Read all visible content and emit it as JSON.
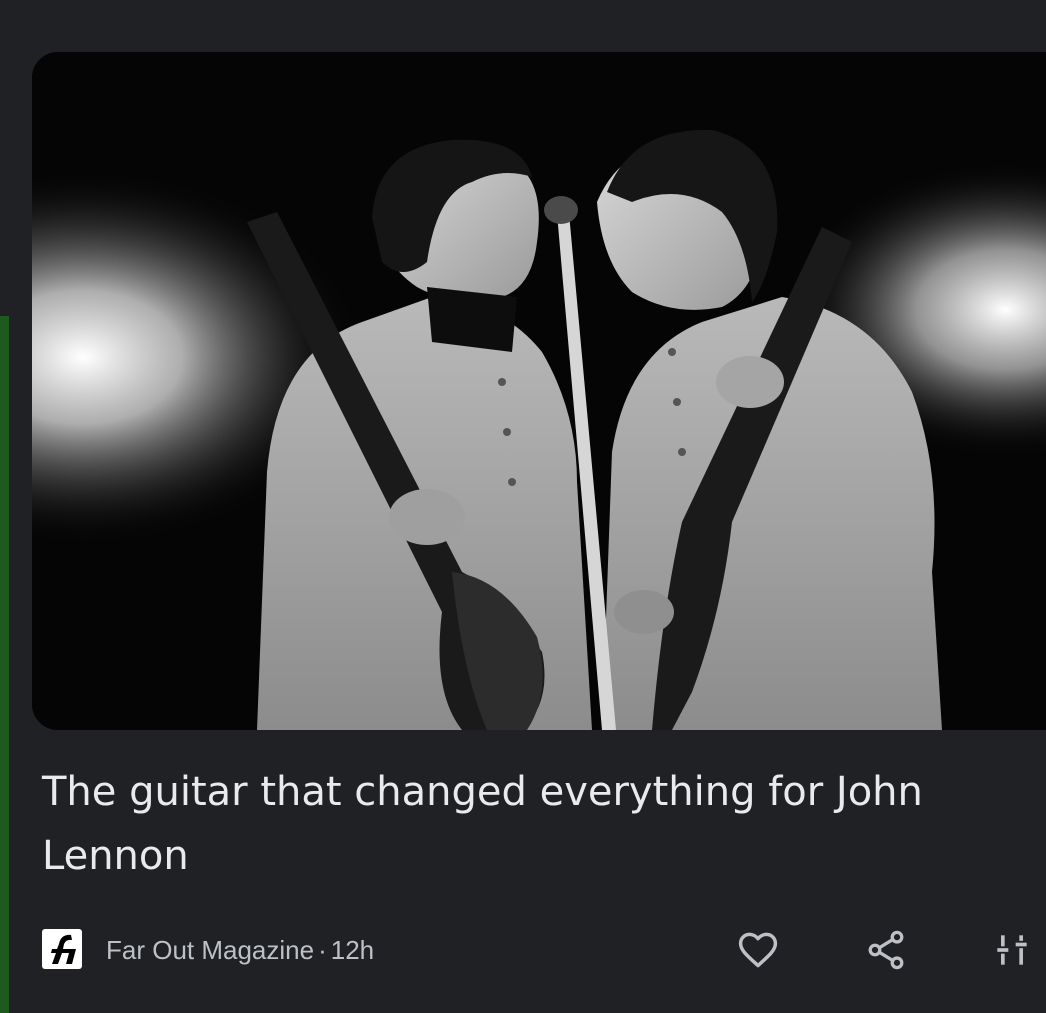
{
  "article": {
    "headline": "The guitar that changed everything for John Lennon",
    "image": {
      "alt": "Black-and-white photo of two musicians in collarless suits singing into a shared microphone while playing guitars on a dark stage",
      "style": "monochrome"
    },
    "source": {
      "name": "Far Out Magazine",
      "separator": "·",
      "age": "12h",
      "logo_icon": "far-out-f-logo"
    },
    "actions": [
      {
        "name": "like",
        "icon": "heart-outline-icon"
      },
      {
        "name": "share",
        "icon": "share-icon"
      },
      {
        "name": "more-options",
        "icon": "tune-sliders-icon"
      }
    ]
  },
  "colors": {
    "background": "#202124",
    "headline_text": "#e8eaed",
    "meta_text": "#bdc1c6",
    "icon": "#bdc1c6",
    "accent_bar": "#1e5a20"
  }
}
